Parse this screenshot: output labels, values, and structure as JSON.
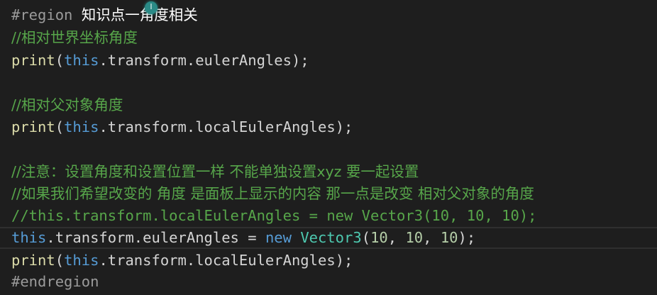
{
  "colors": {
    "background": "#1e1e1e",
    "comment": "#57a64a",
    "keyword": "#569cd6",
    "function": "#dcdcaa",
    "type": "#4ec9b0",
    "number": "#b5cea8",
    "region": "#9b9b9b",
    "text": "#d4d4d4"
  },
  "badge": {
    "icon": "cursor-icon",
    "glyph": "I"
  },
  "code": {
    "line1": {
      "directive": "#region",
      "title_a": "知识点一",
      "title_b": "角度相关"
    },
    "line2": {
      "comment": "//相对世界坐标角度"
    },
    "line3": {
      "fn": "print",
      "open": "(",
      "kw": "this",
      "member": ".transform.eulerAngles",
      "close": ");"
    },
    "line5": {
      "comment": "//相对父对象角度"
    },
    "line6": {
      "fn": "print",
      "open": "(",
      "kw": "this",
      "member": ".transform.localEulerAngles",
      "close": ");"
    },
    "line8": {
      "comment": "//注意：设置角度和设置位置一样 不能单独设置xyz 要一起设置"
    },
    "line9": {
      "comment": "//如果我们希望改变的 角度 是面板上显示的内容 那一点是改变 相对父对象的角度"
    },
    "line10": {
      "comment": "//this.transform.localEulerAngles = new Vector3(10, 10, 10);"
    },
    "line11": {
      "kw": "this",
      "member": ".transform.eulerAngles = ",
      "new_kw": "new",
      "space": " ",
      "type": "Vector3",
      "open": "(",
      "n1": "10",
      "sep1": ", ",
      "n2": "10",
      "sep2": ", ",
      "n3": "10",
      "close": ");"
    },
    "line12": {
      "fn": "print",
      "open": "(",
      "kw": "this",
      "member": ".transform.localEulerAngles",
      "close": ");"
    },
    "line13": {
      "directive": "#endregion"
    }
  }
}
